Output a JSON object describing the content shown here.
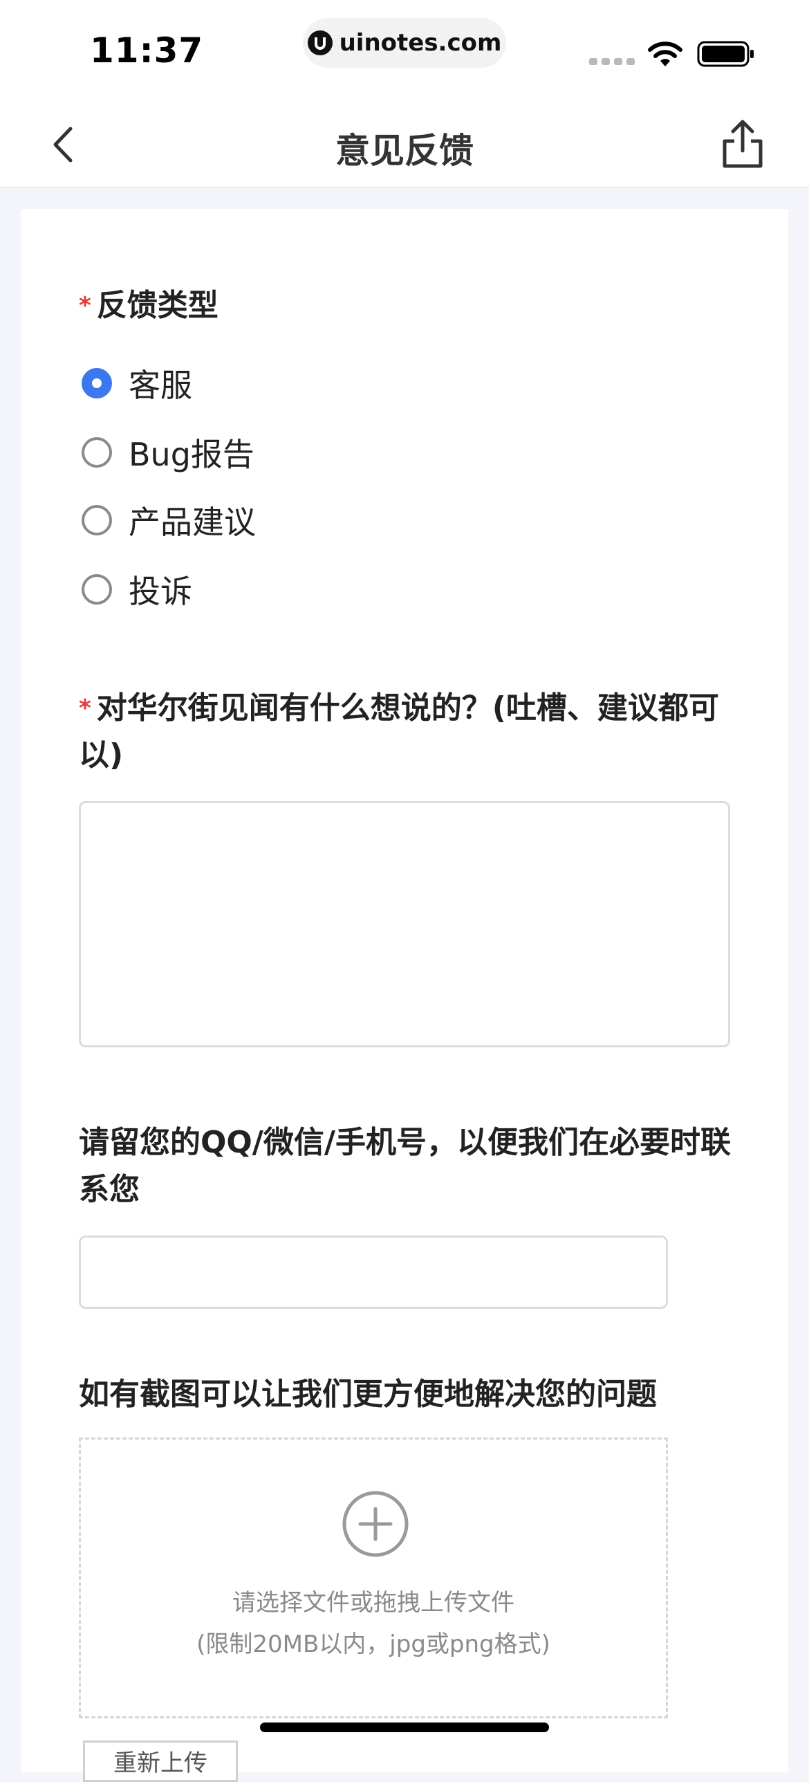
{
  "status_bar": {
    "time": "11:37",
    "url": "uinotes.com"
  },
  "nav": {
    "title": "意见反馈"
  },
  "form": {
    "feedback_type": {
      "required_mark": "*",
      "label": "反馈类型",
      "options": [
        {
          "label": "客服",
          "selected": true
        },
        {
          "label": "Bug报告",
          "selected": false
        },
        {
          "label": "产品建议",
          "selected": false
        },
        {
          "label": "投诉",
          "selected": false
        }
      ]
    },
    "comment": {
      "required_mark": "*",
      "label": "对华尔街见闻有什么想说的？(吐槽、建议都可以)",
      "value": ""
    },
    "contact": {
      "label": "请留您的QQ/微信/手机号，以便我们在必要时联系您",
      "value": ""
    },
    "screenshot": {
      "label": "如有截图可以让我们更方便地解决您的问题",
      "hint_line1": "请选择文件或拖拽上传文件",
      "hint_line2": "(限制20MB以内，jpg或png格式)",
      "reupload_label": "重新上传"
    }
  },
  "colors": {
    "accent": "#3b78f0",
    "required": "#e4393c",
    "page_bg": "#f4f5fa"
  },
  "icons": {
    "back": "chevron-left-icon",
    "share": "share-icon",
    "upload": "plus-circle-icon"
  }
}
